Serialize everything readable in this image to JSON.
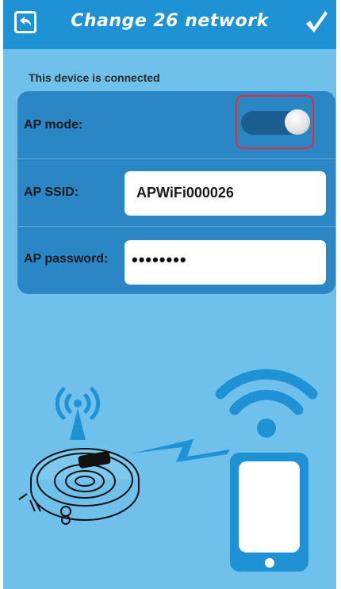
{
  "header": {
    "title": "Change 26 network",
    "back_icon": "back-arrow-icon",
    "confirm_icon": "checkmark-icon"
  },
  "status": {
    "text": "This device is connected"
  },
  "settings": {
    "ap_mode": {
      "label": "AP mode:",
      "enabled": true
    },
    "ap_ssid": {
      "label": "AP SSID:",
      "value": "APWiFi000026"
    },
    "ap_password": {
      "label": "AP password:",
      "masked_value": "••••••••"
    }
  },
  "illustration": {
    "icons": [
      "robot-vacuum-icon",
      "antenna-signal-icon",
      "wifi-icon",
      "smartphone-icon",
      "lightning-link-icon"
    ]
  },
  "colors": {
    "header_bg": "#1f92d6",
    "screen_bg": "#6fc0ea",
    "card_bg": "#2a86c4",
    "highlight": "#e2303b",
    "accent_blue": "#1f92d6"
  }
}
